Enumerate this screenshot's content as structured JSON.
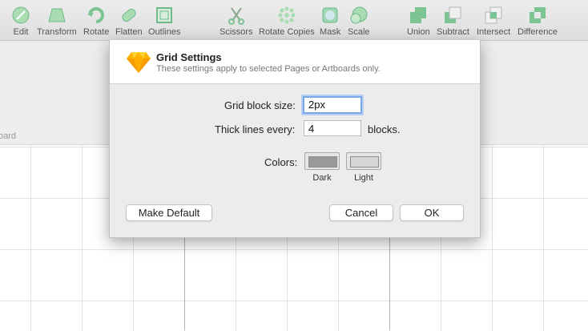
{
  "toolbar": {
    "items": [
      {
        "label": "Edit",
        "icon": "edit-icon"
      },
      {
        "label": "Transform",
        "icon": "transform-icon"
      },
      {
        "label": "Rotate",
        "icon": "rotate-icon"
      },
      {
        "label": "Flatten",
        "icon": "flatten-icon"
      },
      {
        "label": "Outlines",
        "icon": "outlines-icon"
      },
      {
        "label": "Scissors",
        "icon": "scissors-icon"
      },
      {
        "label": "Rotate Copies",
        "icon": "rotate-copies-icon"
      },
      {
        "label": "Mask",
        "icon": "mask-icon"
      },
      {
        "label": "Scale",
        "icon": "scale-icon"
      },
      {
        "label": "Union",
        "icon": "union-icon"
      },
      {
        "label": "Subtract",
        "icon": "subtract-icon"
      },
      {
        "label": "Intersect",
        "icon": "intersect-icon"
      },
      {
        "label": "Difference",
        "icon": "difference-icon"
      }
    ]
  },
  "canvas": {
    "artboard_label": "oard"
  },
  "dialog": {
    "title": "Grid Settings",
    "subtitle": "These settings apply to selected Pages or Artboards only.",
    "icon": "sketch-diamond-icon",
    "grid_block_size": {
      "label": "Grid block size:",
      "value": "2px"
    },
    "thick_lines": {
      "label": "Thick lines every:",
      "value": "4",
      "suffix": "blocks."
    },
    "colors": {
      "label": "Colors:",
      "dark": {
        "label": "Dark",
        "color": "#999999"
      },
      "light": {
        "label": "Light",
        "color": "#d6d6d6"
      }
    },
    "buttons": {
      "make_default": "Make Default",
      "cancel": "Cancel",
      "ok": "OK"
    }
  }
}
